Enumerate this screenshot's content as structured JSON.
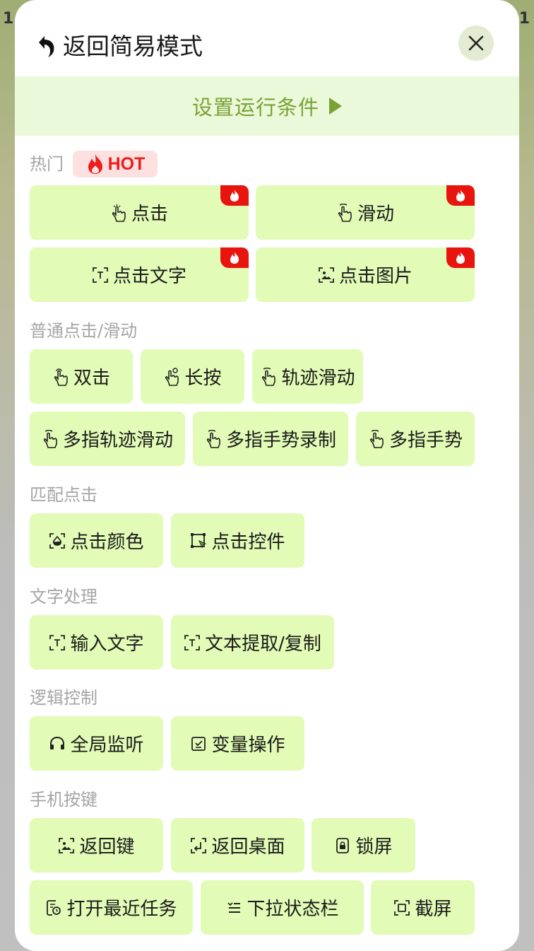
{
  "header": {
    "title": "返回简易模式"
  },
  "condition_bar": {
    "label": "设置运行条件"
  },
  "hot": {
    "section_label": "热门",
    "badge_label": "HOT"
  },
  "sections": {
    "normal": "普通点击/滑动",
    "match": "匹配点击",
    "text": "文字处理",
    "logic": "逻辑控制",
    "keys": "手机按键"
  },
  "buttons": {
    "tap": "点击",
    "swipe": "滑动",
    "tap_text": "点击文字",
    "tap_image": "点击图片",
    "double_tap": "双击",
    "long_press": "长按",
    "path_swipe": "轨迹滑动",
    "multi_path_swipe": "多指轨迹滑动",
    "multi_gesture_record": "多指手势录制",
    "multi_gesture": "多指手势",
    "tap_color": "点击颜色",
    "tap_widget": "点击控件",
    "input_text": "输入文字",
    "extract_text": "文本提取/复制",
    "global_listen": "全局监听",
    "variable_op": "变量操作",
    "back_key": "返回键",
    "home_key": "返回桌面",
    "lock_screen": "锁屏",
    "recent_tasks": "打开最近任务",
    "status_bar": "下拉状态栏",
    "screenshot": "截屏"
  },
  "colors": {
    "accent_green": "#7aa135",
    "button_bg": "#e2fbb6",
    "hot_red": "#e8150f",
    "section_gray": "#a5a5a5"
  }
}
